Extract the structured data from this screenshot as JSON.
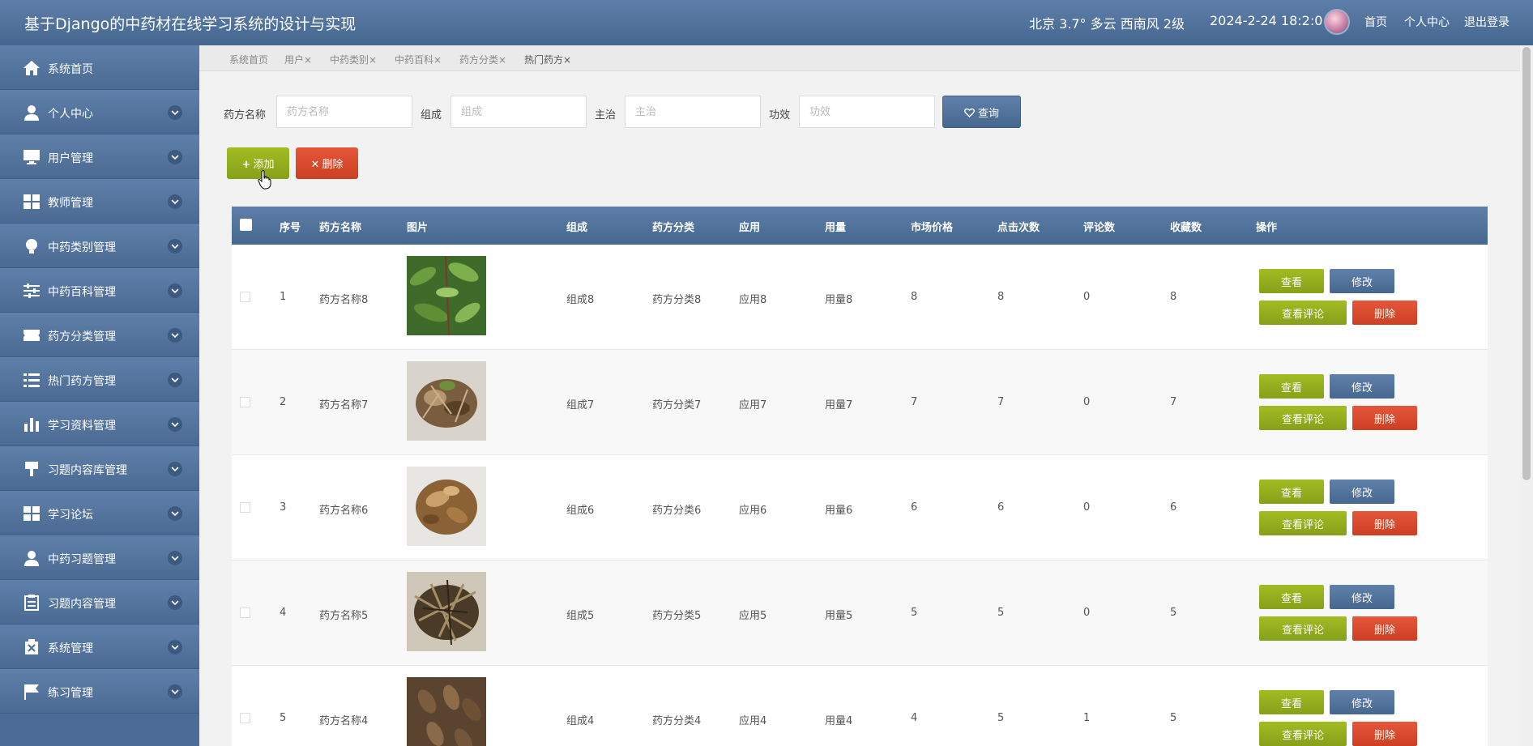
{
  "header": {
    "title": "基于Django的中药材在线学习系统的设计与实现",
    "weather": "北京  3.7°  多云  西南风  2级",
    "datetime": "2024-2-24 18:2:0",
    "links": [
      "首页",
      "个人中心",
      "退出登录"
    ]
  },
  "sidebar": {
    "items": [
      {
        "label": "系统首页",
        "icon": "home-icon"
      },
      {
        "label": "个人中心",
        "icon": "user-icon"
      },
      {
        "label": "用户管理",
        "icon": "monitor-icon"
      },
      {
        "label": "教师管理",
        "icon": "grid-icon"
      },
      {
        "label": "中药类别管理",
        "icon": "bulb-icon"
      },
      {
        "label": "中药百科管理",
        "icon": "sliders-icon"
      },
      {
        "label": "药方分类管理",
        "icon": "ticket-icon"
      },
      {
        "label": "热门药方管理",
        "icon": "list-icon"
      },
      {
        "label": "学习资料管理",
        "icon": "bar-chart-icon"
      },
      {
        "label": "习题内容库管理",
        "icon": "brush-icon"
      },
      {
        "label": "学习论坛",
        "icon": "grid-icon"
      },
      {
        "label": "中药习题管理",
        "icon": "user-icon"
      },
      {
        "label": "习题内容管理",
        "icon": "clipboard-icon"
      },
      {
        "label": "系统管理",
        "icon": "trash-x-icon"
      },
      {
        "label": "练习管理",
        "icon": "flag-icon"
      }
    ]
  },
  "tabs": [
    "系统首页",
    "用户×",
    "中药类别×",
    "中药百科×",
    "药方分类×",
    "热门药方×"
  ],
  "search": {
    "fields": [
      {
        "label": "药方名称",
        "placeholder": "药方名称",
        "value": ""
      },
      {
        "label": "组成",
        "placeholder": "组成",
        "value": ""
      },
      {
        "label": "主治",
        "placeholder": "主治",
        "value": ""
      },
      {
        "label": "功效",
        "placeholder": "功效",
        "value": ""
      }
    ],
    "query_label": "查询",
    "add_label": "添加",
    "delete_label": "删除"
  },
  "table": {
    "columns": [
      "序号",
      "药方名称",
      "图片",
      "组成",
      "药方分类",
      "应用",
      "用量",
      "市场价格",
      "点击次数",
      "评论数",
      "收藏数",
      "操作"
    ],
    "rows": [
      {
        "no": "1",
        "name": "药方名称8",
        "compose": "组成8",
        "category": "药方分类8",
        "apply": "应用8",
        "dose": "用量8",
        "price": "8",
        "clicks": "8",
        "comments": "0",
        "favs": "8"
      },
      {
        "no": "2",
        "name": "药方名称7",
        "compose": "组成7",
        "category": "药方分类7",
        "apply": "应用7",
        "dose": "用量7",
        "price": "7",
        "clicks": "7",
        "comments": "0",
        "favs": "7"
      },
      {
        "no": "3",
        "name": "药方名称6",
        "compose": "组成6",
        "category": "药方分类6",
        "apply": "应用6",
        "dose": "用量6",
        "price": "6",
        "clicks": "6",
        "comments": "0",
        "favs": "6"
      },
      {
        "no": "4",
        "name": "药方名称5",
        "compose": "组成5",
        "category": "药方分类5",
        "apply": "应用5",
        "dose": "用量5",
        "price": "5",
        "clicks": "5",
        "comments": "0",
        "favs": "5"
      },
      {
        "no": "5",
        "name": "药方名称4",
        "compose": "组成4",
        "category": "药方分类4",
        "apply": "应用4",
        "dose": "用量4",
        "price": "4",
        "clicks": "5",
        "comments": "1",
        "favs": "5"
      }
    ],
    "actions": {
      "view": "查看",
      "edit": "修改",
      "comments": "查看评论",
      "delete": "删除"
    }
  },
  "colors": {
    "header": "#4f719b",
    "sidebar": "#4b6c96",
    "green": "#95b01f",
    "red": "#d9472b",
    "blue": "#5574a0"
  }
}
